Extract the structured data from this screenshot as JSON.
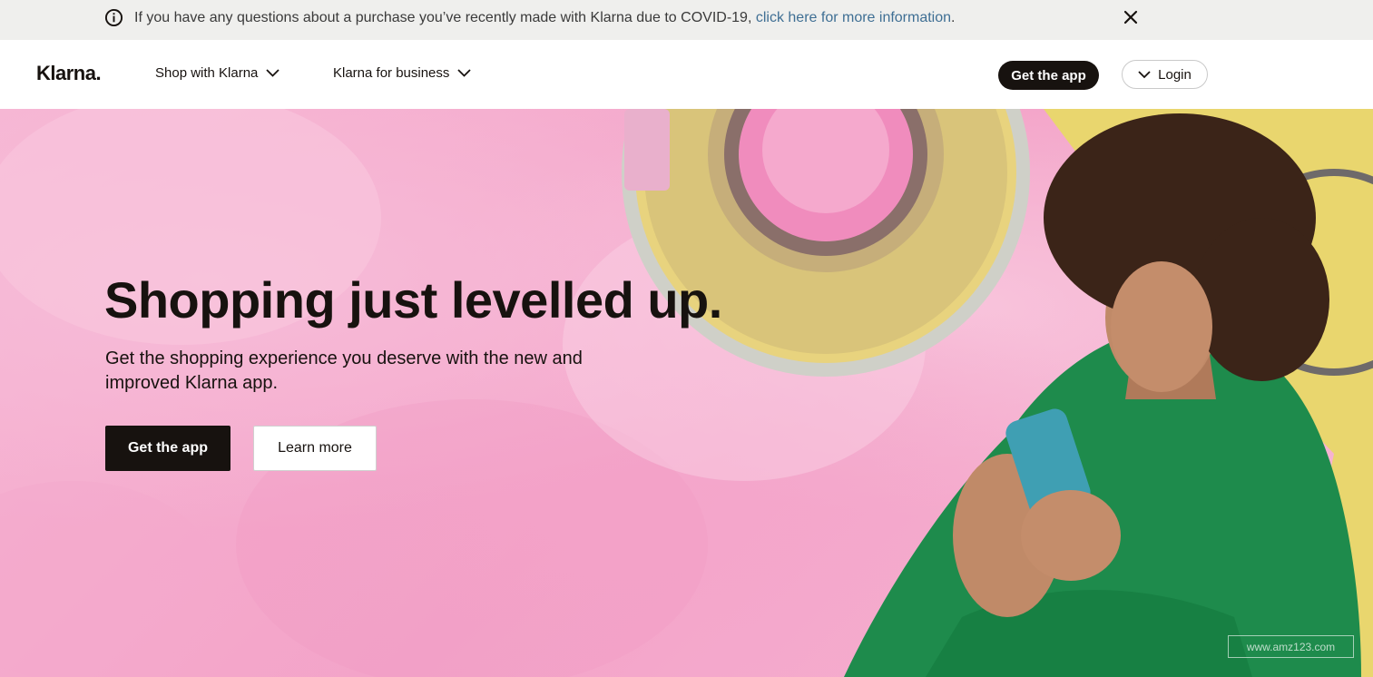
{
  "notice": {
    "text": "If you have any questions about a purchase you’ve recently made with Klarna due to COVID-19, ",
    "link_text": "click here for more information",
    "trailing": ".",
    "icon": "info-icon",
    "close_icon": "close-icon"
  },
  "header": {
    "logo": "Klarna.",
    "nav": [
      {
        "label": "Shop with Klarna",
        "icon": "chevron-down-icon"
      },
      {
        "label": "Klarna for business",
        "icon": "chevron-down-icon"
      }
    ],
    "get_app_label": "Get the app",
    "login_label": "Login"
  },
  "hero": {
    "title": "Shopping just levelled up.",
    "subtitle": "Get the shopping experience you deserve with the new and improved Klarna app.",
    "primary_label": "Get the app",
    "secondary_label": "Learn more",
    "watermark": "www.amz123.com"
  },
  "colors": {
    "brand_dark": "#17120f",
    "pink_bg": "#f6b5d3",
    "link": "#3f6f94",
    "banner_bg": "#efefed"
  }
}
